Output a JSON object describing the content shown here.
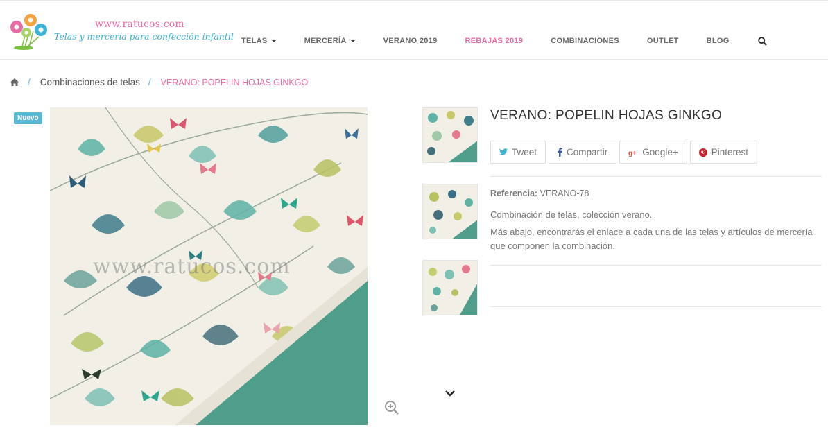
{
  "header": {
    "logo_url_text": "www.ratucos.com",
    "logo_tagline": "Telas y mercería para confección infantil",
    "nav": [
      {
        "label": "TELAS",
        "dropdown": true
      },
      {
        "label": "MERCERÍA",
        "dropdown": true
      },
      {
        "label": "VERANO 2019",
        "dropdown": false
      },
      {
        "label": "REBAJAS 2019",
        "dropdown": false,
        "highlight": "#e86aa6"
      },
      {
        "label": "COMBINACIONES",
        "dropdown": false
      },
      {
        "label": "OUTLET",
        "dropdown": false
      },
      {
        "label": "BLOG",
        "dropdown": false
      }
    ],
    "search_icon": "search-icon"
  },
  "breadcrumb": {
    "home_icon": "home-icon",
    "separator": "/",
    "link": "Combinaciones de telas",
    "current": "VERANO: POPELIN HOJAS GINKGO"
  },
  "product": {
    "badge": "Nuevo",
    "watermark": "www.ratucos.com",
    "title": "VERANO: POPELIN HOJAS GINKGO",
    "share": {
      "tweet": "Tweet",
      "facebook": "Compartir",
      "google": "Google+",
      "pinterest": "Pinterest"
    },
    "reference_label": "Referencia:",
    "reference_value": "VERANO-78",
    "description_1": "Combinación de telas, colección verano.",
    "description_2": "Más abajo, encontrarás el enlace a cada una de las telas y artículos de mercería que componen la combinación."
  },
  "colors": {
    "accent_pink": "#e86aa6",
    "accent_blue": "#5ab9d6",
    "fabric_green": "#4f9e8c"
  }
}
